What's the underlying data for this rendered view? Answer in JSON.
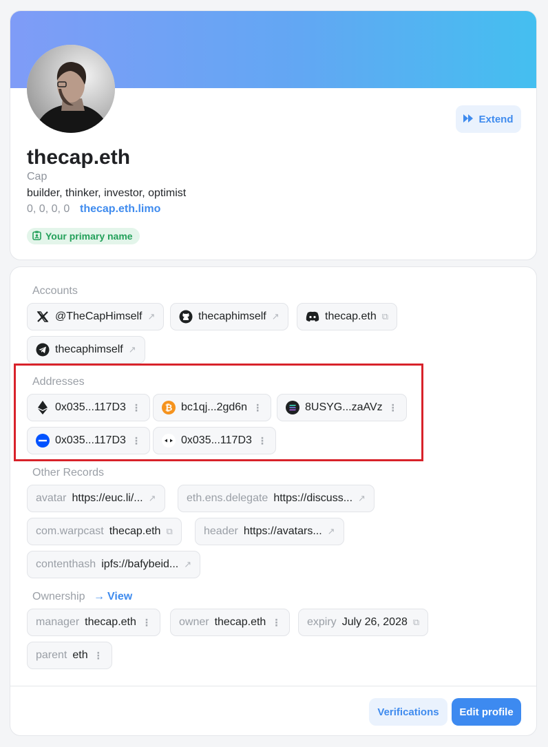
{
  "profile": {
    "name": "thecap.eth",
    "display_name": "Cap",
    "bio": "builder, thinker, investor, optimist",
    "location": "0, 0, 0, 0",
    "url": "thecap.eth.limo",
    "primary_badge": "Your primary name",
    "extend_label": "Extend"
  },
  "accounts": {
    "title": "Accounts",
    "items": [
      {
        "label": "@TheCapHimself",
        "icon": "x-icon",
        "action": "external-link-icon"
      },
      {
        "label": "thecaphimself",
        "icon": "github-icon",
        "action": "external-link-icon"
      },
      {
        "label": "thecap.eth",
        "icon": "discord-icon",
        "action": "copy-icon"
      },
      {
        "label": "thecaphimself",
        "icon": "telegram-icon",
        "action": "external-link-icon"
      }
    ]
  },
  "addresses": {
    "title": "Addresses",
    "items": [
      {
        "label": "0x035...117D3",
        "icon": "ethereum-icon"
      },
      {
        "label": "bc1qj...2gd6n",
        "icon": "bitcoin-icon"
      },
      {
        "label": "8USYG...zaAVz",
        "icon": "solana-icon"
      },
      {
        "label": "0x035...117D3",
        "icon": "base-icon"
      },
      {
        "label": "0x035...117D3",
        "icon": "chain-icon"
      }
    ]
  },
  "other_records": {
    "title": "Other Records",
    "items": [
      {
        "key": "avatar",
        "value": "https://euc.li/...",
        "action": "external-link-icon"
      },
      {
        "key": "eth.ens.delegate",
        "value": "https://discuss...",
        "action": "external-link-icon"
      },
      {
        "key": "com.warpcast",
        "value": "thecap.eth",
        "action": "copy-icon"
      },
      {
        "key": "header",
        "value": "https://avatars...",
        "action": "external-link-icon"
      },
      {
        "key": "contenthash",
        "value": "ipfs://bafybeid...",
        "action": "external-link-icon"
      }
    ]
  },
  "ownership": {
    "title": "Ownership",
    "view_label": "View",
    "items": [
      {
        "key": "manager",
        "value": "thecap.eth",
        "action": "more-icon"
      },
      {
        "key": "owner",
        "value": "thecap.eth",
        "action": "more-icon"
      },
      {
        "key": "expiry",
        "value": "July 26, 2028",
        "action": "copy-icon"
      },
      {
        "key": "parent",
        "value": "eth",
        "action": "more-icon"
      }
    ]
  },
  "footer": {
    "verifications_label": "Verifications",
    "edit_label": "Edit profile"
  },
  "colors": {
    "accent": "#3d8af0",
    "highlight": "#d8222a",
    "primary_badge": "#23a05a"
  }
}
